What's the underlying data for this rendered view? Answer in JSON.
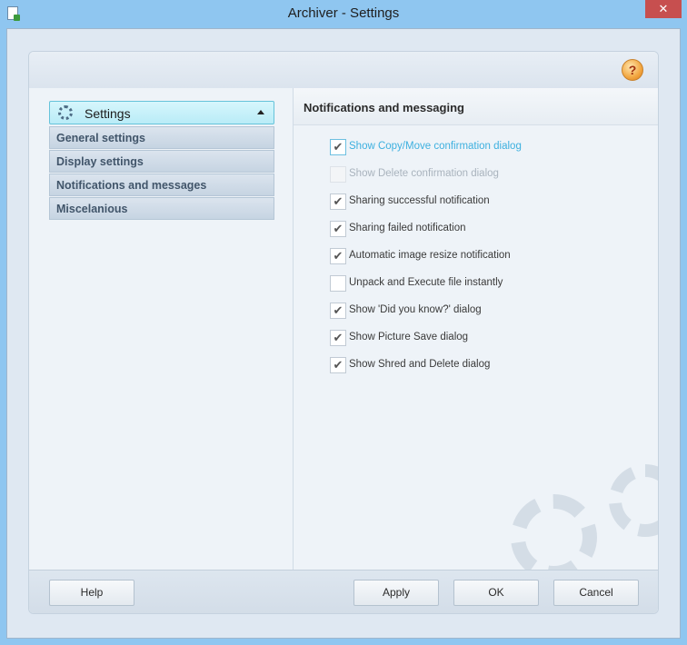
{
  "window": {
    "title": "Archiver - Settings",
    "close": "✕"
  },
  "help_orb": "?",
  "sidebar": {
    "header_label": "Settings",
    "items": [
      {
        "label": "General settings"
      },
      {
        "label": "Display settings"
      },
      {
        "label": "Notifications and messages"
      },
      {
        "label": "Miscelanious"
      }
    ]
  },
  "main": {
    "section_title": "Notifications and messaging",
    "options": [
      {
        "label": "Show Copy/Move confirmation dialog",
        "checked": true,
        "mark": "✔",
        "state": "highlight"
      },
      {
        "label": "Show Delete confirmation dialog",
        "checked": false,
        "mark": "",
        "state": "disabled"
      },
      {
        "label": "Sharing successful notification",
        "checked": true,
        "mark": "✔",
        "state": "normal"
      },
      {
        "label": "Sharing failed notification",
        "checked": true,
        "mark": "✔",
        "state": "normal"
      },
      {
        "label": "Automatic image resize notification",
        "checked": true,
        "mark": "✔",
        "state": "normal"
      },
      {
        "label": "Unpack and Execute file instantly",
        "checked": false,
        "mark": "",
        "state": "normal"
      },
      {
        "label": "Show 'Did you know?' dialog",
        "checked": true,
        "mark": "✔",
        "state": "normal"
      },
      {
        "label": "Show Picture Save dialog",
        "checked": true,
        "mark": "✔",
        "state": "normal"
      },
      {
        "label": "Show Shred and Delete dialog",
        "checked": true,
        "mark": "✔",
        "state": "normal"
      }
    ]
  },
  "footer": {
    "help_label": "Help",
    "apply_label": "Apply",
    "ok_label": "OK",
    "cancel_label": "Cancel"
  }
}
